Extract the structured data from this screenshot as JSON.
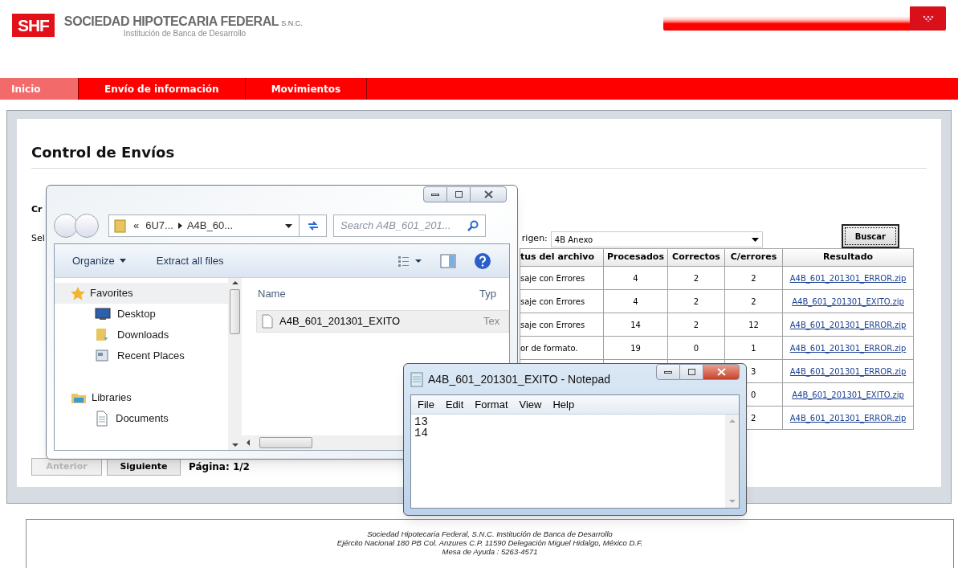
{
  "header": {
    "logo_mark": "SHF",
    "org_name": "SOCIEDAD HIPOTECARIA FEDERAL",
    "org_suffix": "S.N.C.",
    "tagline": "Institución de Banca de Desarrollo"
  },
  "nav": [
    {
      "label": "Inicio",
      "selected": true
    },
    {
      "label": "Envío de información",
      "selected": false
    },
    {
      "label": "Movimientos",
      "selected": false
    }
  ],
  "page": {
    "title": "Control de Envíos",
    "label_1": "Cr",
    "label_2": "Sel",
    "origin_label": "rigen:",
    "origin_value": "4B Anexo",
    "search_button": "Buscar"
  },
  "table": {
    "columns": [
      "tus del archivo",
      "Procesados",
      "Correctos",
      "C/errores",
      "Resultado"
    ],
    "rows": [
      {
        "status": "saje con Errores",
        "processed": "4",
        "correct": "2",
        "errors": "2",
        "result": "A4B_601_201301_ERROR.zip"
      },
      {
        "status": "saje con Errores",
        "processed": "4",
        "correct": "2",
        "errors": "2",
        "result": "A4B_601_201301_EXITO.zip"
      },
      {
        "status": "saje con Errores",
        "processed": "14",
        "correct": "2",
        "errors": "12",
        "result": "A4B_601_201301_ERROR.zip"
      },
      {
        "status": "or de formato.",
        "processed": "19",
        "correct": "0",
        "errors": "1",
        "result": "A4B_601_201301_ERROR.zip"
      },
      {
        "errors": "3",
        "result": "A4B_601_201301_ERROR.zip"
      },
      {
        "errors": "0",
        "result": "A4B_601_201301_EXITO.zip"
      },
      {
        "errors": "2",
        "result": "A4B_601_201301_ERROR.zip"
      }
    ]
  },
  "pagination": {
    "previous": {
      "label": "Anterior",
      "disabled": true
    },
    "next": {
      "label": "Siguiente",
      "disabled": false
    },
    "page": "Página: 1/2"
  },
  "footer": [
    "Sociedad Hipotecaria Federal, S.N.C. Institución de Banca de Desarrollo",
    "Ejército Nacional 180 PB Col. Anzures C.P. 11590 Delegación Miguel Hidalgo, México D.F.",
    "Mesa de Ayuda :  5263-4571"
  ],
  "explorer": {
    "breadcrumb_sep": "«",
    "path": [
      "6U7...",
      "A4B_60..."
    ],
    "search_placeholder": "Search A4B_601_201...",
    "toolbar": [
      "Organize",
      "Extract all files"
    ],
    "nav": [
      {
        "label": "Favorites",
        "kind": "group"
      },
      {
        "label": "Desktop",
        "kind": "desktop"
      },
      {
        "label": "Downloads",
        "kind": "downloads"
      },
      {
        "label": "Recent Places",
        "kind": "recent"
      },
      {
        "label": "Libraries",
        "kind": "group"
      },
      {
        "label": "Documents",
        "kind": "documents"
      }
    ],
    "columns": [
      "Name",
      "Typ"
    ],
    "files": [
      {
        "name": "A4B_601_201301_EXITO",
        "type": "Tex"
      }
    ]
  },
  "notepad": {
    "title": "A4B_601_201301_EXITO - Notepad",
    "menu": [
      "File",
      "Edit",
      "Format",
      "View",
      "Help"
    ],
    "lines": [
      "13",
      "14"
    ]
  }
}
